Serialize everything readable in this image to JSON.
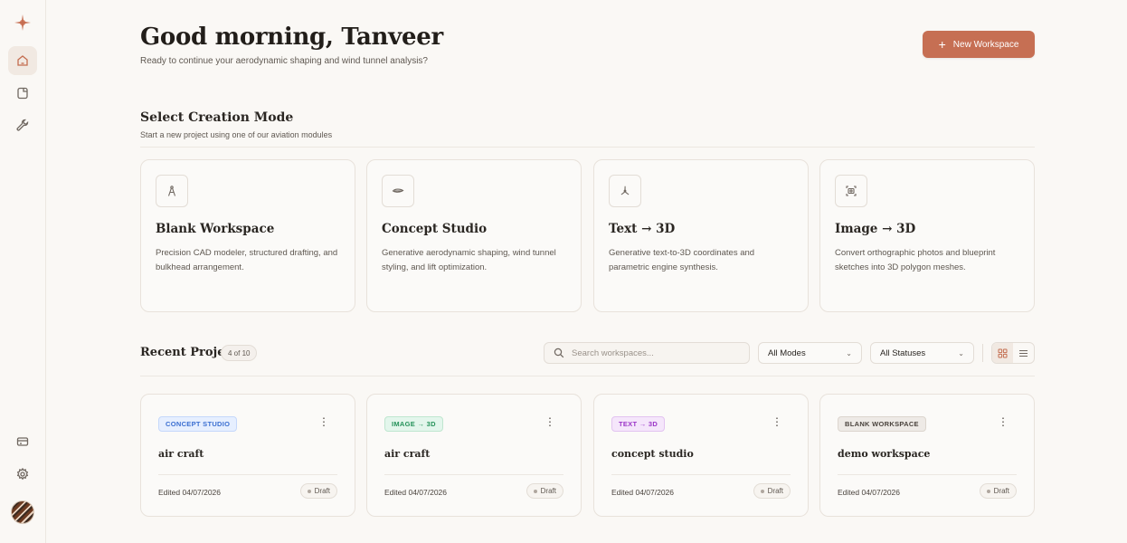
{
  "header": {
    "greeting": "Good morning, Tanveer",
    "subtitle": "Ready to continue your aerodynamic shaping and wind tunnel analysis?",
    "new_button": "New Workspace"
  },
  "creation": {
    "title": "Select Creation Mode",
    "subtitle": "Start a new project using one of our aviation modules",
    "modes": [
      {
        "title": "Blank Workspace",
        "desc": "Precision CAD modeler, structured drafting, and bulkhead arrangement.",
        "icon": "compass-icon"
      },
      {
        "title": "Concept Studio",
        "desc": "Generative aerodynamic shaping, wind tunnel styling, and lift optimization.",
        "icon": "airfoil-icon"
      },
      {
        "title": "Text → 3D",
        "desc": "Generative text-to-3D coordinates and parametric engine synthesis.",
        "icon": "propeller-icon"
      },
      {
        "title": "Image → 3D",
        "desc": "Convert orthographic photos and blueprint sketches into 3D polygon meshes.",
        "icon": "image-scan-icon"
      }
    ]
  },
  "recent": {
    "title": "Recent Projects",
    "count": "4 of 10",
    "search_placeholder": "Search workspaces...",
    "mode_filter": "All Modes",
    "status_filter": "All Statuses",
    "projects": [
      {
        "tag": "CONCEPT STUDIO",
        "name": "air craft",
        "edited": "Edited 04/07/2026",
        "status": "Draft",
        "tag_color": "#3b6fd1",
        "tag_bg": "#e6efff",
        "tag_border": "#c5d8fb"
      },
      {
        "tag": "IMAGE → 3D",
        "name": "air craft",
        "edited": "Edited 04/07/2026",
        "status": "Draft",
        "tag_color": "#25925a",
        "tag_bg": "#e3f6ec",
        "tag_border": "#bfe6d0"
      },
      {
        "tag": "TEXT → 3D",
        "name": "concept studio",
        "edited": "Edited 04/07/2026",
        "status": "Draft",
        "tag_color": "#9b35c7",
        "tag_bg": "#f5e6fb",
        "tag_border": "#e2c3f1"
      },
      {
        "tag": "BLANK WORKSPACE",
        "name": "demo workspace",
        "edited": "Edited 04/07/2026",
        "status": "Draft",
        "tag_color": "#4a433d",
        "tag_bg": "#eeeae6",
        "tag_border": "#dcd5ce"
      }
    ]
  },
  "colors": {
    "accent": "#c66f53",
    "background": "#faf8f5"
  }
}
